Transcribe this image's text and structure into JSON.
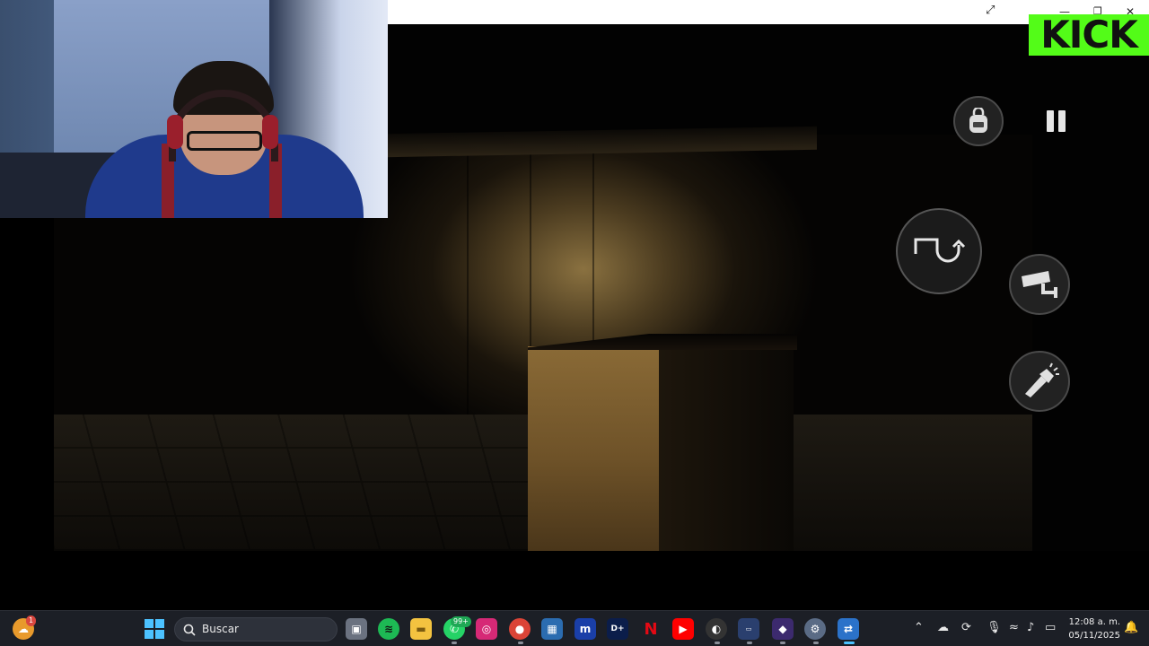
{
  "window": {
    "expand_glyph": "⤢",
    "minimize_glyph": "—",
    "restore_glyph": "❐",
    "close_glyph": "✕"
  },
  "overlay": {
    "kick_logo": "KICK",
    "kick_color": "#53fc18"
  },
  "hud": {
    "buttons": [
      {
        "name": "backpack-icon"
      },
      {
        "name": "pause-icon"
      },
      {
        "name": "turn-around-icon"
      },
      {
        "name": "security-camera-icon"
      },
      {
        "name": "flashlight-icon"
      }
    ]
  },
  "taskbar": {
    "search_placeholder": "Buscar",
    "whatsapp_badge": "99+",
    "weather_badge": "1",
    "apps": [
      "start-icon",
      "search-icon",
      "task-view-icon",
      "spotify-icon",
      "file-explorer-icon",
      "whatsapp-icon",
      "instagram-icon",
      "chrome-icon",
      "microsoft-store-icon",
      "app-m-icon",
      "disney-plus-icon",
      "netflix-icon",
      "youtube-icon",
      "app-icon",
      "app-icon",
      "app-icon",
      "settings-icon",
      "network-app-icon"
    ],
    "clock": {
      "time": "12:08 a. m.",
      "date": "05/11/2025"
    }
  }
}
